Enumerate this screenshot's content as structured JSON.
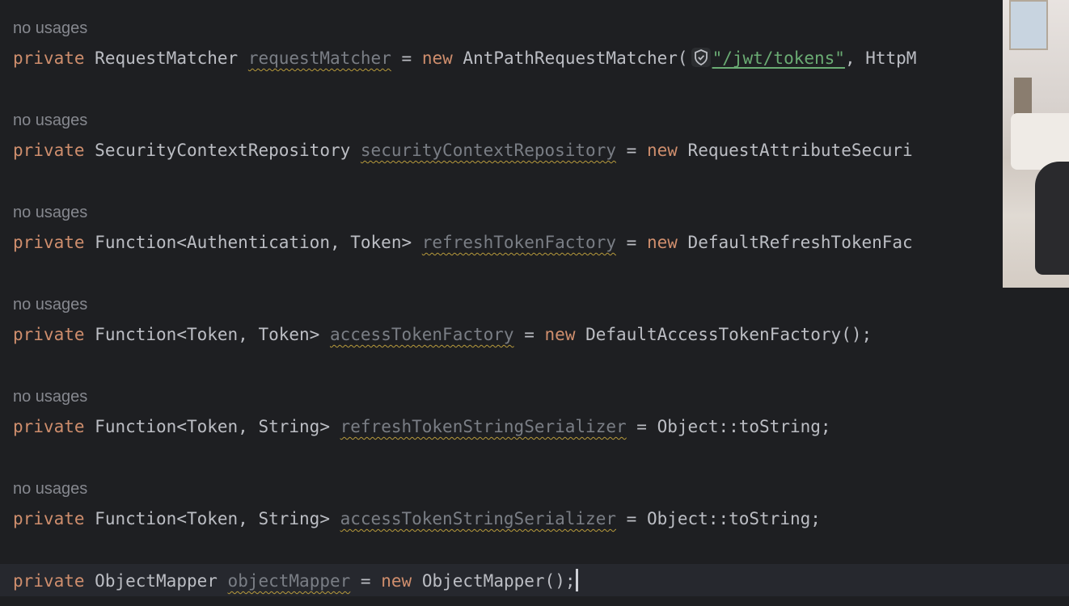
{
  "editor": {
    "usage_hint": "no usages",
    "lines": [
      {
        "keyword": "private",
        "type": "RequestMatcher",
        "field": "requestMatcher",
        "assign": "=",
        "new_kw": "new",
        "ctor": "AntPathRequestMatcher(",
        "string": "\"/jwt/tokens\"",
        "rest": ", HttpM"
      },
      {
        "keyword": "private",
        "type": "SecurityContextRepository",
        "field": "securityContextRepository",
        "assign": "=",
        "new_kw": "new",
        "ctor": "RequestAttributeSecuri"
      },
      {
        "keyword": "private",
        "type": "Function<Authentication, Token>",
        "field": "refreshTokenFactory",
        "assign": "=",
        "new_kw": "new",
        "ctor": "DefaultRefreshTokenFac"
      },
      {
        "keyword": "private",
        "type": "Function<Token, Token>",
        "field": "accessTokenFactory",
        "assign": "=",
        "new_kw": "new",
        "ctor": "DefaultAccessTokenFactory();"
      },
      {
        "keyword": "private",
        "type": "Function<Token, String>",
        "field": "refreshTokenStringSerializer",
        "assign": "=",
        "value": "Object::toString;"
      },
      {
        "keyword": "private",
        "type": "Function<Token, String>",
        "field": "accessTokenStringSerializer",
        "assign": "=",
        "value": "Object::toString;"
      },
      {
        "keyword": "private",
        "type": "ObjectMapper",
        "field": "objectMapper",
        "assign": "=",
        "new_kw": "new",
        "ctor": "ObjectMapper();"
      }
    ]
  },
  "icons": {
    "language_injection": "shield-check-icon"
  },
  "colors": {
    "background": "#1e1f22",
    "keyword": "#cf8e6d",
    "string": "#6aab73",
    "hint": "#86888f",
    "unused_field": "#7a7e85",
    "warning_underline": "#b89b3c"
  }
}
